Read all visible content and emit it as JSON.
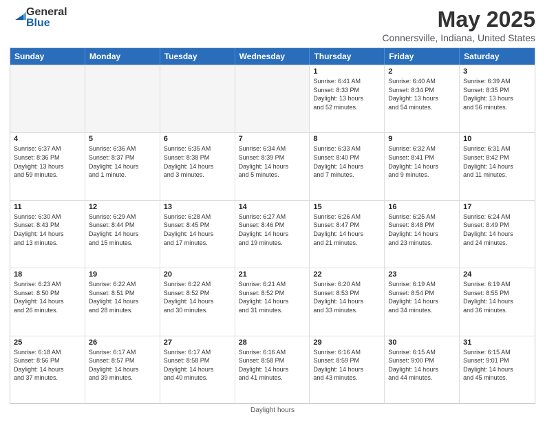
{
  "header": {
    "logo": {
      "general": "General",
      "blue": "Blue"
    },
    "title": "May 2025",
    "subtitle": "Connersville, Indiana, United States"
  },
  "calendar": {
    "days_of_week": [
      "Sunday",
      "Monday",
      "Tuesday",
      "Wednesday",
      "Thursday",
      "Friday",
      "Saturday"
    ],
    "rows": [
      [
        {
          "day": "",
          "info": "",
          "empty": true
        },
        {
          "day": "",
          "info": "",
          "empty": true
        },
        {
          "day": "",
          "info": "",
          "empty": true
        },
        {
          "day": "",
          "info": "",
          "empty": true
        },
        {
          "day": "1",
          "info": "Sunrise: 6:41 AM\nSunset: 8:33 PM\nDaylight: 13 hours\nand 52 minutes.",
          "empty": false
        },
        {
          "day": "2",
          "info": "Sunrise: 6:40 AM\nSunset: 8:34 PM\nDaylight: 13 hours\nand 54 minutes.",
          "empty": false
        },
        {
          "day": "3",
          "info": "Sunrise: 6:39 AM\nSunset: 8:35 PM\nDaylight: 13 hours\nand 56 minutes.",
          "empty": false
        }
      ],
      [
        {
          "day": "4",
          "info": "Sunrise: 6:37 AM\nSunset: 8:36 PM\nDaylight: 13 hours\nand 59 minutes.",
          "empty": false
        },
        {
          "day": "5",
          "info": "Sunrise: 6:36 AM\nSunset: 8:37 PM\nDaylight: 14 hours\nand 1 minute.",
          "empty": false
        },
        {
          "day": "6",
          "info": "Sunrise: 6:35 AM\nSunset: 8:38 PM\nDaylight: 14 hours\nand 3 minutes.",
          "empty": false
        },
        {
          "day": "7",
          "info": "Sunrise: 6:34 AM\nSunset: 8:39 PM\nDaylight: 14 hours\nand 5 minutes.",
          "empty": false
        },
        {
          "day": "8",
          "info": "Sunrise: 6:33 AM\nSunset: 8:40 PM\nDaylight: 14 hours\nand 7 minutes.",
          "empty": false
        },
        {
          "day": "9",
          "info": "Sunrise: 6:32 AM\nSunset: 8:41 PM\nDaylight: 14 hours\nand 9 minutes.",
          "empty": false
        },
        {
          "day": "10",
          "info": "Sunrise: 6:31 AM\nSunset: 8:42 PM\nDaylight: 14 hours\nand 11 minutes.",
          "empty": false
        }
      ],
      [
        {
          "day": "11",
          "info": "Sunrise: 6:30 AM\nSunset: 8:43 PM\nDaylight: 14 hours\nand 13 minutes.",
          "empty": false
        },
        {
          "day": "12",
          "info": "Sunrise: 6:29 AM\nSunset: 8:44 PM\nDaylight: 14 hours\nand 15 minutes.",
          "empty": false
        },
        {
          "day": "13",
          "info": "Sunrise: 6:28 AM\nSunset: 8:45 PM\nDaylight: 14 hours\nand 17 minutes.",
          "empty": false
        },
        {
          "day": "14",
          "info": "Sunrise: 6:27 AM\nSunset: 8:46 PM\nDaylight: 14 hours\nand 19 minutes.",
          "empty": false
        },
        {
          "day": "15",
          "info": "Sunrise: 6:26 AM\nSunset: 8:47 PM\nDaylight: 14 hours\nand 21 minutes.",
          "empty": false
        },
        {
          "day": "16",
          "info": "Sunrise: 6:25 AM\nSunset: 8:48 PM\nDaylight: 14 hours\nand 23 minutes.",
          "empty": false
        },
        {
          "day": "17",
          "info": "Sunrise: 6:24 AM\nSunset: 8:49 PM\nDaylight: 14 hours\nand 24 minutes.",
          "empty": false
        }
      ],
      [
        {
          "day": "18",
          "info": "Sunrise: 6:23 AM\nSunset: 8:50 PM\nDaylight: 14 hours\nand 26 minutes.",
          "empty": false
        },
        {
          "day": "19",
          "info": "Sunrise: 6:22 AM\nSunset: 8:51 PM\nDaylight: 14 hours\nand 28 minutes.",
          "empty": false
        },
        {
          "day": "20",
          "info": "Sunrise: 6:22 AM\nSunset: 8:52 PM\nDaylight: 14 hours\nand 30 minutes.",
          "empty": false
        },
        {
          "day": "21",
          "info": "Sunrise: 6:21 AM\nSunset: 8:52 PM\nDaylight: 14 hours\nand 31 minutes.",
          "empty": false
        },
        {
          "day": "22",
          "info": "Sunrise: 6:20 AM\nSunset: 8:53 PM\nDaylight: 14 hours\nand 33 minutes.",
          "empty": false
        },
        {
          "day": "23",
          "info": "Sunrise: 6:19 AM\nSunset: 8:54 PM\nDaylight: 14 hours\nand 34 minutes.",
          "empty": false
        },
        {
          "day": "24",
          "info": "Sunrise: 6:19 AM\nSunset: 8:55 PM\nDaylight: 14 hours\nand 36 minutes.",
          "empty": false
        }
      ],
      [
        {
          "day": "25",
          "info": "Sunrise: 6:18 AM\nSunset: 8:56 PM\nDaylight: 14 hours\nand 37 minutes.",
          "empty": false
        },
        {
          "day": "26",
          "info": "Sunrise: 6:17 AM\nSunset: 8:57 PM\nDaylight: 14 hours\nand 39 minutes.",
          "empty": false
        },
        {
          "day": "27",
          "info": "Sunrise: 6:17 AM\nSunset: 8:58 PM\nDaylight: 14 hours\nand 40 minutes.",
          "empty": false
        },
        {
          "day": "28",
          "info": "Sunrise: 6:16 AM\nSunset: 8:58 PM\nDaylight: 14 hours\nand 41 minutes.",
          "empty": false
        },
        {
          "day": "29",
          "info": "Sunrise: 6:16 AM\nSunset: 8:59 PM\nDaylight: 14 hours\nand 43 minutes.",
          "empty": false
        },
        {
          "day": "30",
          "info": "Sunrise: 6:15 AM\nSunset: 9:00 PM\nDaylight: 14 hours\nand 44 minutes.",
          "empty": false
        },
        {
          "day": "31",
          "info": "Sunrise: 6:15 AM\nSunset: 9:01 PM\nDaylight: 14 hours\nand 45 minutes.",
          "empty": false
        }
      ]
    ],
    "footer_note": "Daylight hours"
  }
}
